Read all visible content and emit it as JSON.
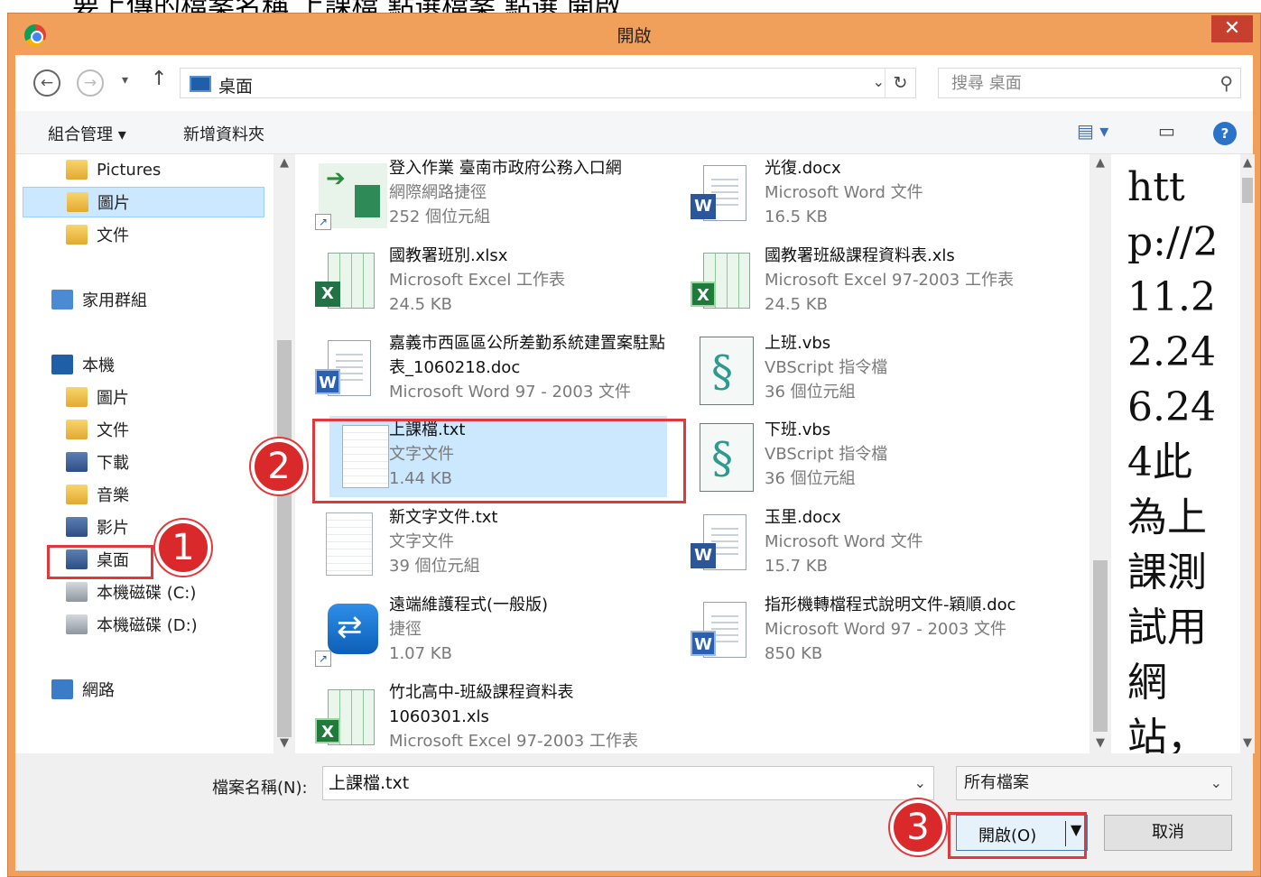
{
  "caption": "要上傳的檔案名稱 上課檔 點選檔案 點選 開啟",
  "dialog": {
    "title": "開啟",
    "close": "✕"
  },
  "address": {
    "location": "桌面",
    "search_placeholder": "搜尋 桌面"
  },
  "toolbar": {
    "organize": "組合管理 ▾",
    "new_folder": "新增資料夾"
  },
  "nav": {
    "items": [
      {
        "label": "Pictures"
      },
      {
        "label": "圖片"
      },
      {
        "label": "文件"
      },
      {
        "label": "家用群組"
      },
      {
        "label": "本機"
      },
      {
        "label": "圖片"
      },
      {
        "label": "文件"
      },
      {
        "label": "下載"
      },
      {
        "label": "音樂"
      },
      {
        "label": "影片"
      },
      {
        "label": "桌面"
      },
      {
        "label": "本機磁碟 (C:)"
      },
      {
        "label": "本機磁碟 (D:)"
      },
      {
        "label": "網路"
      }
    ]
  },
  "files": [
    {
      "name": "登入作業 臺南市政府公務入口網",
      "type": "網際網路捷徑",
      "size": "252 個位元組"
    },
    {
      "name": "光復.docx",
      "type": "Microsoft Word 文件",
      "size": "16.5 KB"
    },
    {
      "name": "國教署班別.xlsx",
      "type": "Microsoft Excel 工作表",
      "size": "24.5 KB"
    },
    {
      "name": "國教署班級課程資料表.xls",
      "type": "Microsoft Excel 97-2003 工作表",
      "size": "24.5 KB"
    },
    {
      "name": "嘉義市西區區公所差勤系統建置案駐點表_1060218.doc",
      "type": "Microsoft Word 97 - 2003 文件",
      "size": ""
    },
    {
      "name": "上班.vbs",
      "type": "VBScript 指令檔",
      "size": "36 個位元組"
    },
    {
      "name": "上課檔.txt",
      "type": "文字文件",
      "size": "1.44 KB"
    },
    {
      "name": "下班.vbs",
      "type": "VBScript 指令檔",
      "size": "36 個位元組"
    },
    {
      "name": "新文字文件.txt",
      "type": "文字文件",
      "size": "39 個位元組"
    },
    {
      "name": "玉里.docx",
      "type": "Microsoft Word 文件",
      "size": "15.7 KB"
    },
    {
      "name": "遠端維護程式(一般版)",
      "type": "捷徑",
      "size": "1.07 KB"
    },
    {
      "name": "指形機轉檔程式說明文件-穎順.doc",
      "type": "Microsoft Word 97 - 2003 文件",
      "size": "850 KB"
    },
    {
      "name": "竹北高中-班級課程資料表1060301.xls",
      "type": "Microsoft Excel 97-2003 工作表",
      "size": ""
    }
  ],
  "preview": {
    "text": "http://211.22.246.244此為上課測試用網站，"
  },
  "bottom": {
    "filename_label": "檔案名稱(N):",
    "filename_value": "上課檔.txt",
    "filter": "所有檔案",
    "open": "開啟(O)",
    "cancel": "取消"
  },
  "steps": [
    "1",
    "2",
    "3"
  ],
  "colors": {
    "title_bar": "#f0a05a",
    "highlight": "#e0393b",
    "selection": "#cce8ff"
  }
}
